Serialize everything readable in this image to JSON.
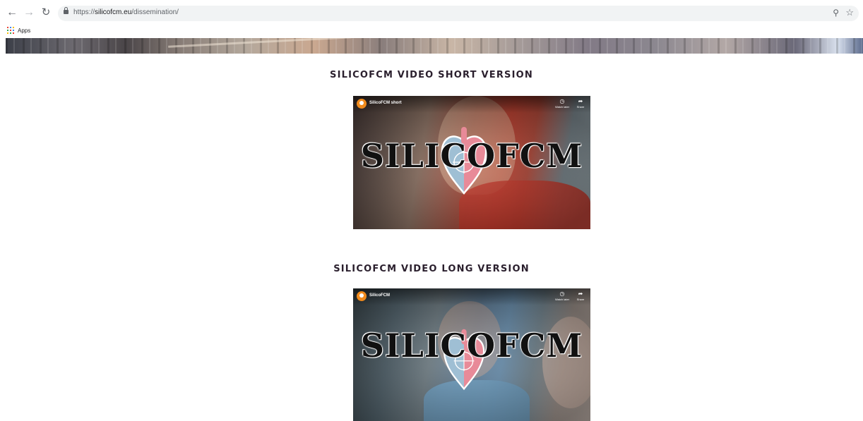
{
  "browser": {
    "url_scheme": "https://",
    "url_host": "silicofcm.eu",
    "url_path": "/dissemination/",
    "bookmarks": [
      {
        "label": "Apps"
      }
    ],
    "apps_icon_colors": [
      "#ea4335",
      "#4285f4",
      "#fbbc05",
      "#34a853",
      "#ea4335",
      "#4285f4",
      "#fbbc05",
      "#34a853",
      "#ea4335"
    ]
  },
  "sections": [
    {
      "title": "SILICOFCM VIDEO SHORT VERSION",
      "video": {
        "channel_title": "SilicoFCM short",
        "logo_text": "SILICOFCM",
        "watch_later_label": "Watch later",
        "share_label": "Share"
      }
    },
    {
      "title": "SILICOFCM VIDEO LONG VERSION",
      "video": {
        "channel_title": "SilicoFCM",
        "logo_text": "SILICOFCM",
        "watch_later_label": "Watch later",
        "share_label": "Share"
      }
    }
  ],
  "colors": {
    "heading": "#2a1f2d",
    "heart_left": "#9fbfd4",
    "heart_right": "#e88a98",
    "yt_avatar": "#f08a1c"
  }
}
